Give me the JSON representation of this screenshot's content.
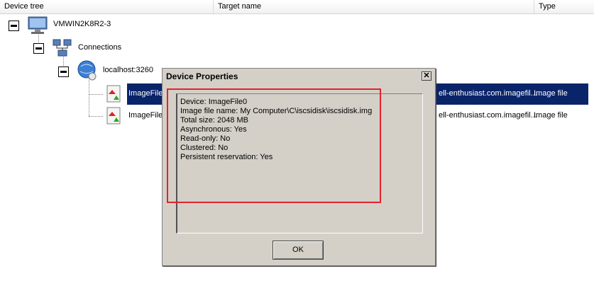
{
  "columns": {
    "device_tree": "Device tree",
    "target_name": "Target name",
    "type": "Type"
  },
  "tree": {
    "root": "VMWIN2K8R2-3",
    "connections": "Connections",
    "host": "localhost:3260",
    "files": [
      {
        "label": "ImageFile",
        "target": "ell-enthusiast.com.imagefil...",
        "type": "Image file",
        "selected": true
      },
      {
        "label": "ImageFile",
        "target": "ell-enthusiast.com.imagefil...",
        "type": "Image file",
        "selected": false
      }
    ]
  },
  "dialog": {
    "title": "Device Properties",
    "close_glyph": "✕",
    "properties": [
      "Device: ImageFile0",
      "Image file name: My Computer\\C\\iscsidisk\\iscsidisk.img",
      "Total size: 2048 MB",
      "Asynchronous: Yes",
      "Read-only: No",
      "Clustered: No",
      "Persistent reservation: Yes"
    ],
    "ok_label": "OK"
  },
  "colors": {
    "selection": "#0a246a",
    "highlight": "#e2222e",
    "dialog_bg": "#d4d0c8"
  }
}
